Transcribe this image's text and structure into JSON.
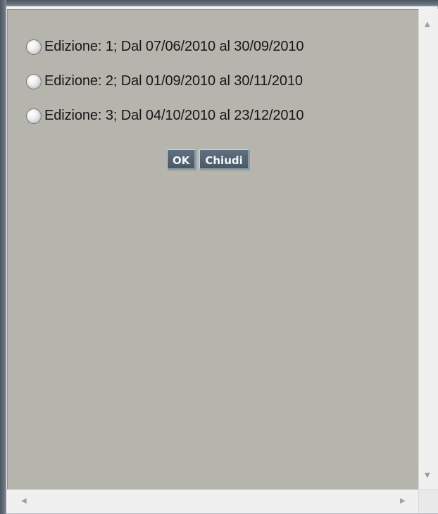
{
  "dialog": {
    "options": [
      {
        "label": "Edizione: 1; Dal 07/06/2010 al 30/09/2010",
        "checked": false
      },
      {
        "label": "Edizione: 2; Dal 01/09/2010 al 30/11/2010",
        "checked": false
      },
      {
        "label": "Edizione: 3; Dal 04/10/2010 al 23/12/2010",
        "checked": false
      }
    ],
    "buttons": {
      "ok_label": "OK",
      "close_label": "Chiudi"
    },
    "background_color": "#b5b5ae",
    "button_color": "#4f5f6d"
  },
  "scrollbars": {
    "up_icon": "scroll-up-icon",
    "down_icon": "scroll-down-icon",
    "left_icon": "scroll-left-icon",
    "right_icon": "scroll-right-icon",
    "glyph_up": "▲",
    "glyph_down": "▼",
    "glyph_left": "◀",
    "glyph_right": "▶"
  }
}
